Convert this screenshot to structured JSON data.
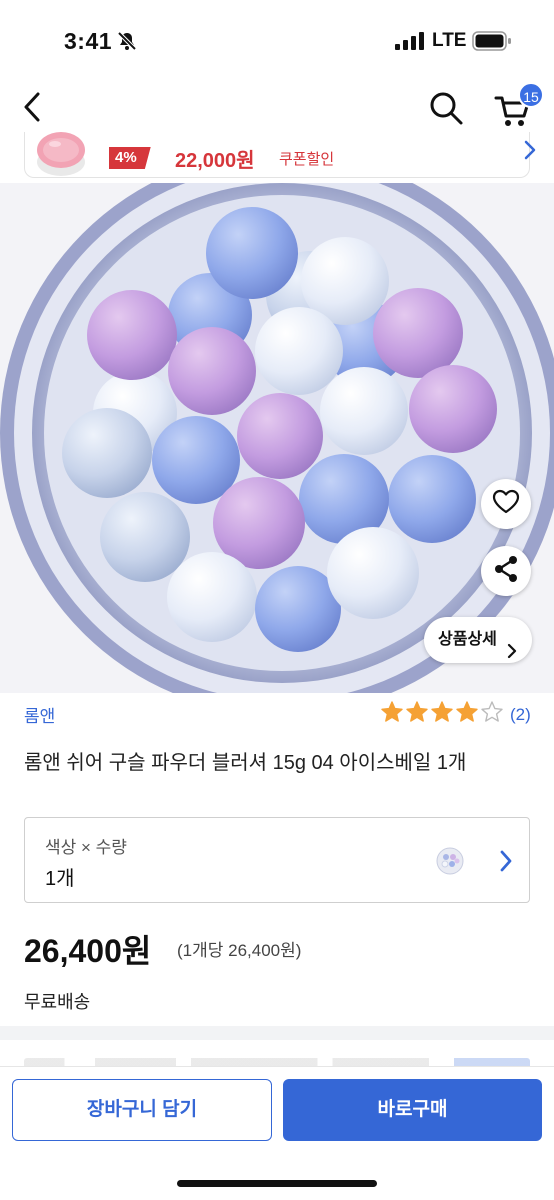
{
  "status_bar": {
    "time": "3:41",
    "network": "LTE"
  },
  "nav": {
    "cart_count": "15"
  },
  "promo": {
    "discount": "4%",
    "price": "22,000원",
    "coupon_label": "쿠폰할인"
  },
  "product": {
    "image_alt_icon": "product-photo",
    "detail_button": "상품상세",
    "brand": "롬앤",
    "rating": {
      "stars": 4,
      "max": 5,
      "count": "(2)"
    },
    "title": "롬앤 쉬어 구슬 파우더 블러셔 15g 04 아이스베일 1개",
    "option": {
      "label": "색상 × 수량",
      "value": "1개"
    },
    "price": "26,400원",
    "unit_price": "(1개당 26,400원)",
    "shipping": "무료배송"
  },
  "bottom_bar": {
    "cart_button": "장바구니 담기",
    "buy_button": "바로구매"
  },
  "colors": {
    "accent": "#3567d6",
    "sale": "#d6363b",
    "star": "#f5a134"
  }
}
